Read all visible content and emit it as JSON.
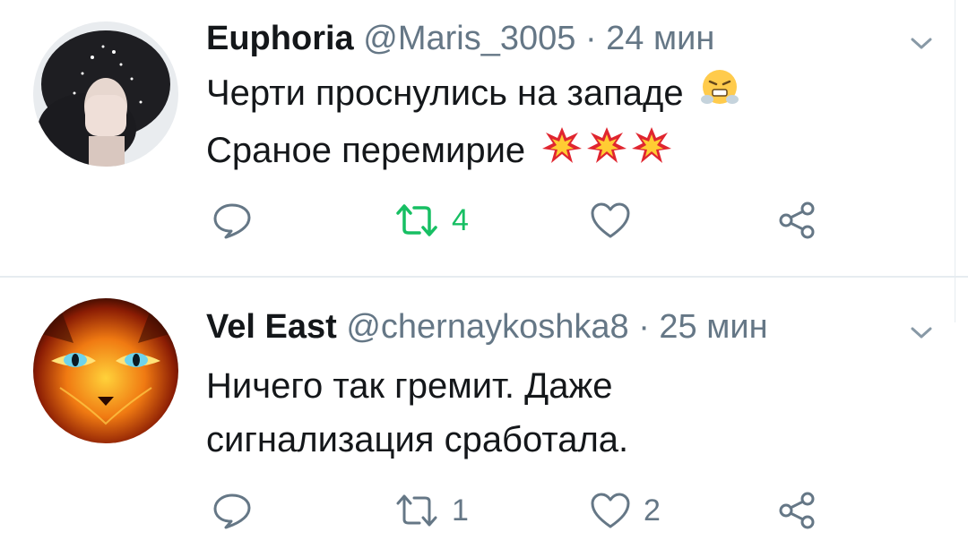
{
  "tweets": [
    {
      "name": "Euphoria",
      "handle": "@Maris_3005",
      "separator": "·",
      "time": "24 мин",
      "lines": [
        "Черти проснулись на западе",
        "Сраное перемирие"
      ],
      "actions": {
        "reply_count": "",
        "retweet_count": "4",
        "like_count": ""
      },
      "retweeted": true
    },
    {
      "name": "Vel East",
      "handle": "@chernaykoshka8",
      "separator": "·",
      "time": "25 мин",
      "lines": [
        "Ничего так гремит. Даже",
        "сигнализация сработала."
      ],
      "actions": {
        "reply_count": "",
        "retweet_count": "1",
        "like_count": "2"
      },
      "retweeted": false
    }
  ],
  "icons": {
    "reply": "reply-icon",
    "retweet": "retweet-icon",
    "like": "heart-icon",
    "share": "share-icon",
    "menu": "chevron-down-icon"
  },
  "colors": {
    "text": "#14171a",
    "secondary": "#657786",
    "retweet_active": "#17bf63",
    "divider": "#e6ecf0"
  }
}
